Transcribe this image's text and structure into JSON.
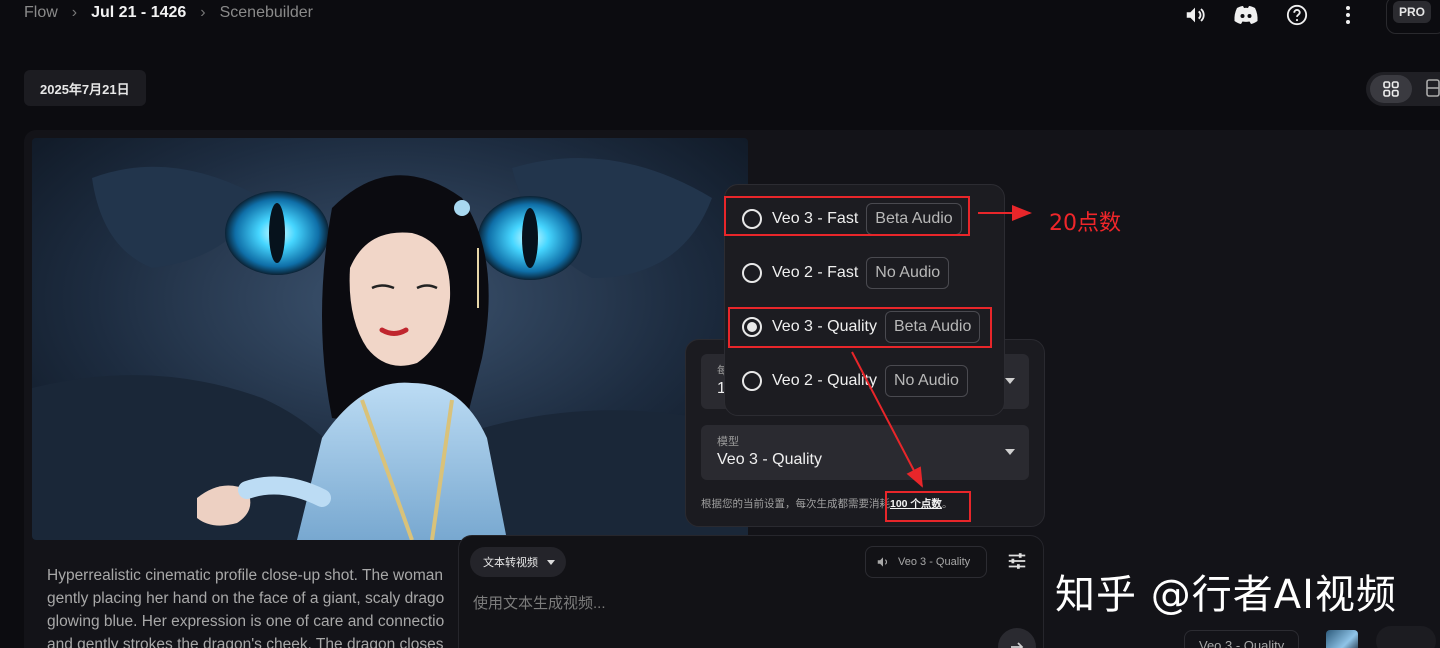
{
  "breadcrumbs": {
    "root": "Flow",
    "project": "Jul 21 - 1426",
    "current": "Scenebuilder"
  },
  "topbar": {
    "badge": "PRO",
    "icons": [
      "volume-icon",
      "discord-icon",
      "help-icon",
      "more-vert-icon"
    ]
  },
  "date_chip": "2025年7月21日",
  "description": "Hyperrealistic cinematic profile close-up shot. The woman gently placing her hand on the face of a giant, scaly drago glowing blue. Her expression is one of care and connectio and gently strokes the dragon's cheek. The dragon closes",
  "settings": {
    "outputs_label": "每",
    "outputs_value": "1",
    "model_label": "模型",
    "model_value": "Veo 3 - Quality",
    "cost_prefix": "根据您的当前设置，每次生成都需要消耗",
    "cost_value": "100 个点数",
    "cost_suffix": "。"
  },
  "model_menu": [
    {
      "label": "Veo 3 - Fast",
      "badge": "Beta Audio",
      "selected": false
    },
    {
      "label": "Veo 2 - Fast",
      "badge": "No Audio",
      "selected": false
    },
    {
      "label": "Veo 3 - Quality",
      "badge": "Beta Audio",
      "selected": true
    },
    {
      "label": "Veo 2 - Quality",
      "badge": "No Audio",
      "selected": false
    }
  ],
  "annotation": "20点数",
  "composer": {
    "mode": "文本转视频",
    "model": "Veo 3 - Quality",
    "placeholder": "使用文本生成视频..."
  },
  "watermark": "知乎 @行者AI视频",
  "bottom": {
    "model_chip": "Veo 3 - Quality"
  },
  "colors": {
    "background": "#0c0c10",
    "annotation_red": "#e8262a"
  }
}
